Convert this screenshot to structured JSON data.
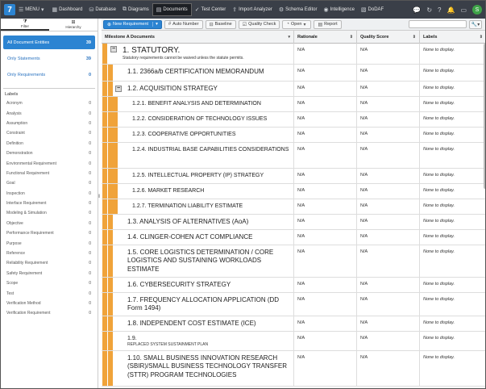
{
  "nav": {
    "logo_letter": "7",
    "items": [
      {
        "icon": "menu-icon",
        "label": "MENU"
      },
      {
        "icon": "dashboard-icon",
        "label": "Dashboard"
      },
      {
        "icon": "database-icon",
        "label": "Database"
      },
      {
        "icon": "diagrams-icon",
        "label": "Diagrams"
      },
      {
        "icon": "documents-icon",
        "label": "Documents",
        "active": true
      },
      {
        "icon": "test-center-icon",
        "label": "Test Center"
      },
      {
        "icon": "import-icon",
        "label": "Import Analyzer"
      },
      {
        "icon": "schema-icon",
        "label": "Schema Editor"
      },
      {
        "icon": "intelligence-icon",
        "label": "Intelligence"
      },
      {
        "icon": "dodaf-icon",
        "label": "DoDAF"
      }
    ],
    "avatar_letter": "S"
  },
  "sidebar": {
    "tabs": [
      {
        "icon": "filter-icon",
        "label": "Filter",
        "active": true
      },
      {
        "icon": "hierarchy-icon",
        "label": "Hierarchy"
      }
    ],
    "filters": [
      {
        "label": "All Document Entities",
        "count": "39",
        "active": true
      },
      {
        "label": "Only Statements",
        "count": "39"
      },
      {
        "label": "Only Requirements",
        "count": "0"
      }
    ],
    "labels_title": "Labels",
    "labels": [
      {
        "name": "Acronym",
        "count": "0"
      },
      {
        "name": "Analysis",
        "count": "0"
      },
      {
        "name": "Assumption",
        "count": "0"
      },
      {
        "name": "Constraint",
        "count": "0"
      },
      {
        "name": "Definition",
        "count": "0"
      },
      {
        "name": "Demonstration",
        "count": "0"
      },
      {
        "name": "Environmental Requirement",
        "count": "0"
      },
      {
        "name": "Functional Requirement",
        "count": "0"
      },
      {
        "name": "Goal",
        "count": "0"
      },
      {
        "name": "Inspection",
        "count": "0"
      },
      {
        "name": "Interface Requirement",
        "count": "0"
      },
      {
        "name": "Modeling & Simulation",
        "count": "0"
      },
      {
        "name": "Objective",
        "count": "0"
      },
      {
        "name": "Performance Requirement",
        "count": "0"
      },
      {
        "name": "Purpose",
        "count": "0"
      },
      {
        "name": "Reference",
        "count": "0"
      },
      {
        "name": "Reliability Requirement",
        "count": "0"
      },
      {
        "name": "Safety Requirement",
        "count": "0"
      },
      {
        "name": "Scope",
        "count": "0"
      },
      {
        "name": "Test",
        "count": "0"
      },
      {
        "name": "Verification Method",
        "count": "0"
      },
      {
        "name": "Verification Requirement",
        "count": "0"
      }
    ]
  },
  "toolbar": {
    "new_requirement": "New Requirement",
    "auto_number": "Auto Number",
    "baseline": "Baseline",
    "quality_check": "Quality Check",
    "open": "Open",
    "report": "Report"
  },
  "grid": {
    "columns": [
      "Milestone A Documents",
      "Rationale",
      "Quality Score",
      "Labels"
    ],
    "na": "N/A",
    "none_label": "None to display.",
    "rows": [
      {
        "title": "1. STATUTORY.",
        "sub": "Statutory requirements cannot be waived unless the statute permits.",
        "level": 0
      },
      {
        "title": "1.1. 2366a/b CERTIFICATION MEMORANDUM",
        "level": 1
      },
      {
        "title": "1.2. ACQUISITION STRATEGY",
        "level": 1
      },
      {
        "title": "1.2.1. BENEFIT ANALYSIS AND DETERMINATION",
        "level": 2
      },
      {
        "title": "1.2.2. CONSIDERATION OF TECHNOLOGY ISSUES",
        "level": 2
      },
      {
        "title": "1.2.3. COOPERATIVE OPPORTUNITIES",
        "level": 2
      },
      {
        "title": "1.2.4. INDUSTRIAL BASE CAPABILITIES CONSIDERATIONS",
        "level": 2
      },
      {
        "title": "1.2.5. INTELLECTUAL PROPERTY (IP) STRATEGY",
        "level": 2
      },
      {
        "title": "1.2.6. MARKET RESEARCH",
        "level": 2
      },
      {
        "title": "1.2.7. TERMINATION LIABILITY ESTIMATE",
        "level": 2
      },
      {
        "title": "1.3. ANALYSIS OF ALTERNATIVES (AoA)",
        "level": 1
      },
      {
        "title": "1.4. CLINGER-COHEN ACT COMPLIANCE",
        "level": 1
      },
      {
        "title": "1.5. CORE LOGISTICS DETERMINATION / CORE LOGISTICS AND SUSTAINING WORKLOADS ESTIMATE",
        "level": 1
      },
      {
        "title": "1.6. CYBERSECURITY STRATEGY",
        "level": 1
      },
      {
        "title": "1.7. FREQUENCY ALLOCATION APPLICATION (DD Form 1494)",
        "level": 1
      },
      {
        "title": "1.8. INDEPENDENT COST ESTIMATE (ICE)",
        "level": 1
      },
      {
        "title": "1.9.",
        "sub": "REPLACED SYSTEM SUSTAINMENT PLAN",
        "level": 1
      },
      {
        "title": "1.10. SMALL BUSINESS INNOVATION RESEARCH (SBIR)/SMALL BUSINESS TECHNOLOGY TRANSFER (STTR) PROGRAM TECHNOLOGIES",
        "level": 1
      }
    ]
  }
}
